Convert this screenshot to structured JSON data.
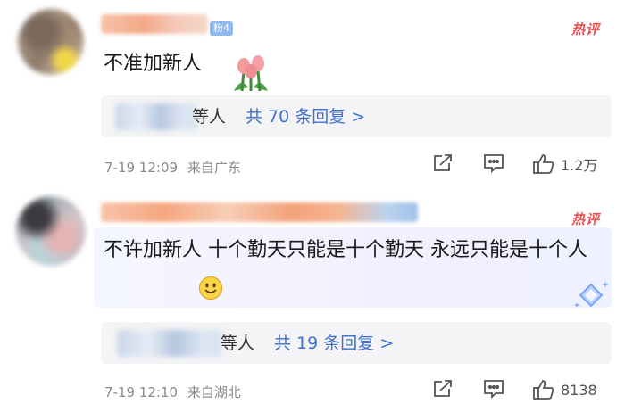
{
  "comments": [
    {
      "fan_badge": "粉4",
      "hot_tag": "热评",
      "text": "不准加新人",
      "reply_others": "等人",
      "reply_count": "共 70 条回复 >",
      "time": "7-19 12:09",
      "location": "来自广东",
      "likes": "1.2万",
      "emoji": "tulip"
    },
    {
      "hot_tag": "热评",
      "text": "不许加新人 十个勤天只能是十个勤天 永远只能是十个人",
      "reply_others": "等人",
      "reply_count": "共 19 条回复 >",
      "time": "7-19 12:10",
      "location": "来自湖北",
      "likes": "8138",
      "emoji": "smiley"
    }
  ],
  "icons": {
    "share": "share-icon",
    "reply": "comment-icon",
    "like": "thumbs-up-icon",
    "badge": "sparkle-diamond-icon"
  },
  "colors": {
    "hot": "#ec4f4f",
    "link": "#3e6fd1",
    "meta": "#8a8a8a"
  }
}
